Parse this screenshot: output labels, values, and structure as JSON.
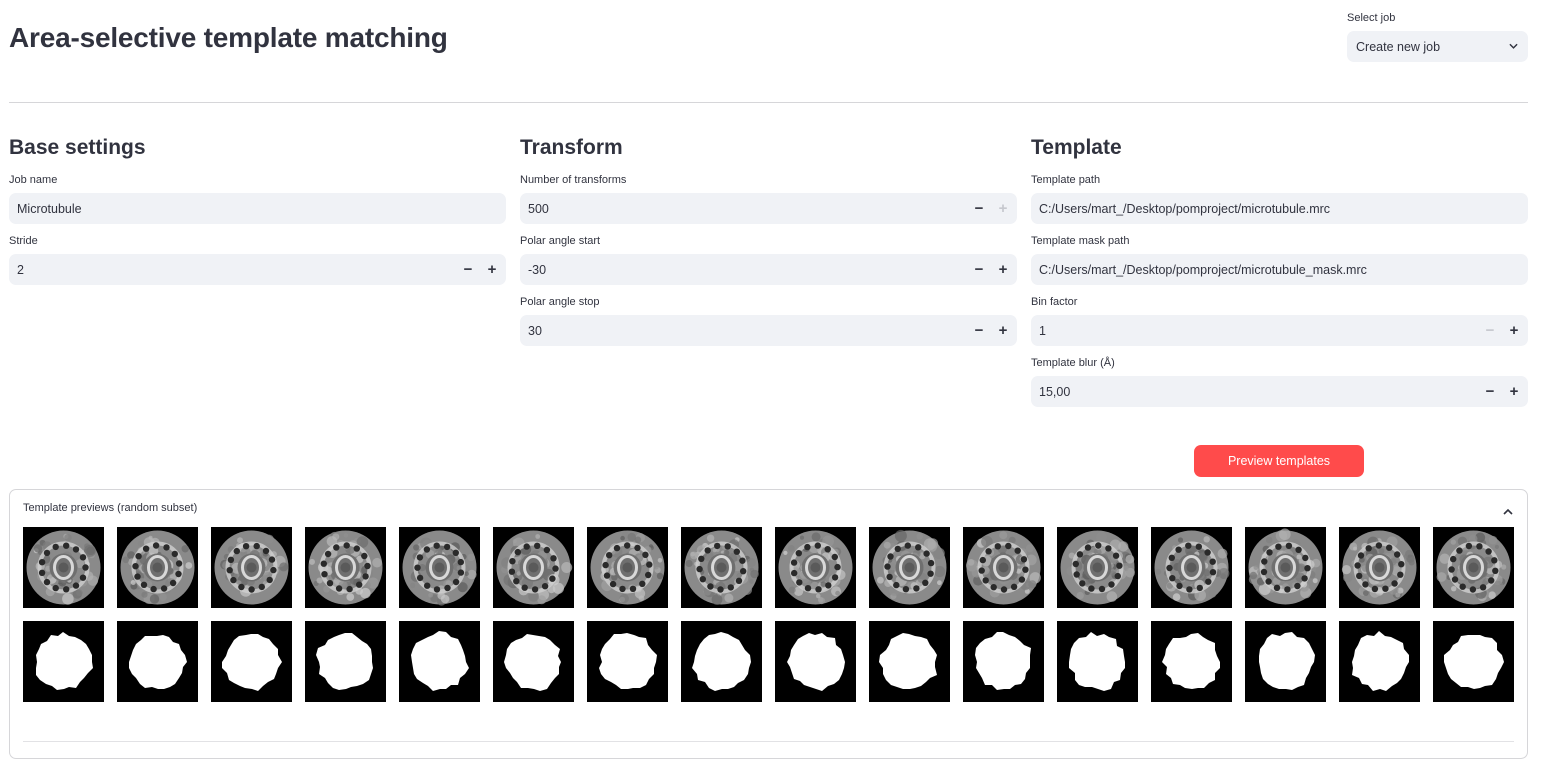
{
  "header": {
    "title": "Area-selective template matching",
    "select_job_label": "Select job",
    "select_job_value": "Create new job"
  },
  "base_settings": {
    "title": "Base settings",
    "job_name_label": "Job name",
    "job_name_value": "Microtubule",
    "stride_label": "Stride",
    "stride_value": "2"
  },
  "transform": {
    "title": "Transform",
    "num_transforms_label": "Number of transforms",
    "num_transforms_value": "500",
    "polar_start_label": "Polar angle start",
    "polar_start_value": "-30",
    "polar_stop_label": "Polar angle stop",
    "polar_stop_value": "30"
  },
  "template": {
    "title": "Template",
    "path_label": "Template path",
    "path_value": "C:/Users/mart_/Desktop/pomproject/microtubule.mrc",
    "mask_path_label": "Template mask path",
    "mask_path_value": "C:/Users/mart_/Desktop/pomproject/microtubule_mask.mrc",
    "bin_label": "Bin factor",
    "bin_value": "1",
    "blur_label": "Template blur (Å)",
    "blur_value": "15,00"
  },
  "preview_button": "Preview templates",
  "previews": {
    "header": "Template previews (random subset)",
    "template_count": 16,
    "mask_count": 16
  },
  "colors": {
    "accent": "#ff4b4b",
    "input_bg": "#f0f2f6",
    "text": "#31333f"
  }
}
